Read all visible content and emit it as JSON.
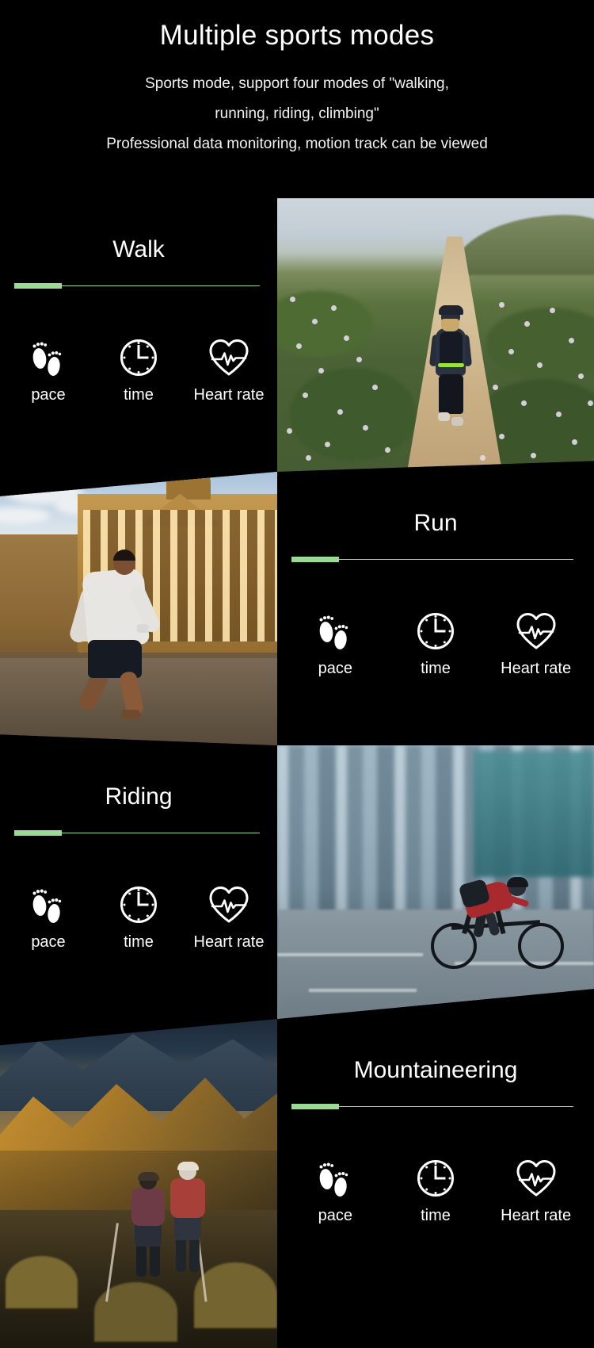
{
  "header": {
    "title": "Multiple sports modes",
    "subtitle_line1": "Sports mode, support four modes of \"walking,",
    "subtitle_line2": "running, riding, climbing\"",
    "subtitle_line3": "Professional data monitoring, motion track can be viewed"
  },
  "accent_color": "#9ada95",
  "background_color": "#000000",
  "text_color": "#ffffff",
  "metric_labels": {
    "pace": "pace",
    "time": "time",
    "heart_rate": "Heart rate"
  },
  "sections": [
    {
      "id": "walk",
      "title": "Walk",
      "text_side": "left",
      "image_side": "right",
      "image_alt": "Woman with backpack walking on a sandy trail through a wildflower meadow",
      "metrics": [
        {
          "icon": "footprints-icon",
          "label": "pace"
        },
        {
          "icon": "clock-icon",
          "label": "time"
        },
        {
          "icon": "heart-rate-icon",
          "label": "Heart rate"
        }
      ]
    },
    {
      "id": "run",
      "title": "Run",
      "text_side": "right",
      "image_side": "left",
      "image_alt": "Man running past a classical columned building at golden hour",
      "metrics": [
        {
          "icon": "footprints-icon",
          "label": "pace"
        },
        {
          "icon": "clock-icon",
          "label": "time"
        },
        {
          "icon": "heart-rate-icon",
          "label": "Heart rate"
        }
      ]
    },
    {
      "id": "riding",
      "title": "Riding",
      "text_side": "left",
      "image_side": "right",
      "image_alt": "Cyclist in red jacket riding through a motion-blurred city street",
      "metrics": [
        {
          "icon": "footprints-icon",
          "label": "pace"
        },
        {
          "icon": "clock-icon",
          "label": "time"
        },
        {
          "icon": "heart-rate-icon",
          "label": "Heart rate"
        }
      ]
    },
    {
      "id": "mountaineering",
      "title": "Mountaineering",
      "text_side": "right",
      "image_side": "left",
      "image_alt": "Two hikers with backpacks climbing a golden rocky mountain ridge",
      "metrics": [
        {
          "icon": "footprints-icon",
          "label": "pace"
        },
        {
          "icon": "clock-icon",
          "label": "time"
        },
        {
          "icon": "heart-rate-icon",
          "label": "Heart rate"
        }
      ]
    }
  ]
}
